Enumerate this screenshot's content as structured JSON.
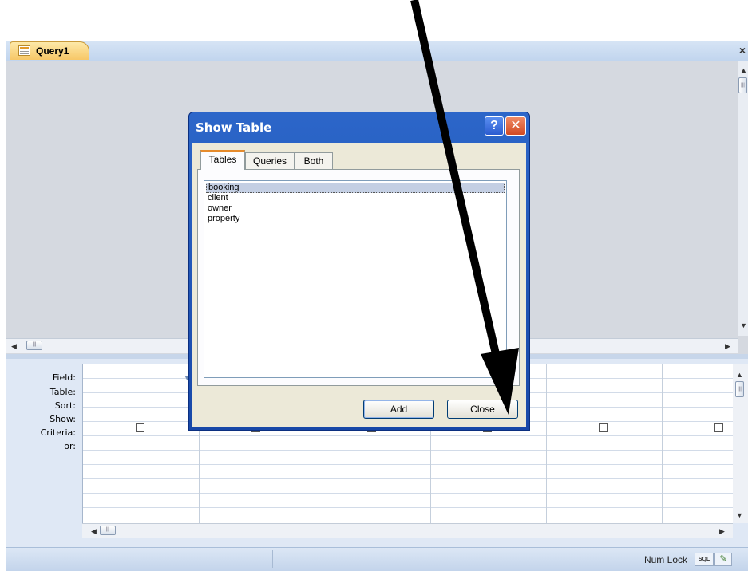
{
  "window": {
    "tab_title": "Query1",
    "close_glyph": "×"
  },
  "design_grid": {
    "row_labels": [
      "Field:",
      "Table:",
      "Sort:",
      "Show:",
      "Criteria:",
      "or:"
    ],
    "columns": 6
  },
  "statusbar": {
    "num_lock": "Num Lock",
    "sql_view": "SQL"
  },
  "dialog": {
    "title": "Show Table",
    "help_glyph": "?",
    "close_glyph": "✕",
    "tabs": [
      {
        "label": "Tables",
        "active": true
      },
      {
        "label": "Queries",
        "active": false
      },
      {
        "label": "Both",
        "active": false
      }
    ],
    "tables": [
      "booking",
      "client",
      "owner",
      "property"
    ],
    "selected_table": "booking",
    "add_label": "Add",
    "close_label": "Close"
  },
  "icons": {
    "query": "query-icon",
    "scroll_up": "▲",
    "scroll_down": "▼",
    "scroll_left": "◀",
    "scroll_right": "▶"
  },
  "colors": {
    "dialog_title_bar": "#2c66c9",
    "active_tab_accent": "#e68b2c",
    "doc_tab": "#f7c767",
    "annotation_arrow": "#000000"
  }
}
